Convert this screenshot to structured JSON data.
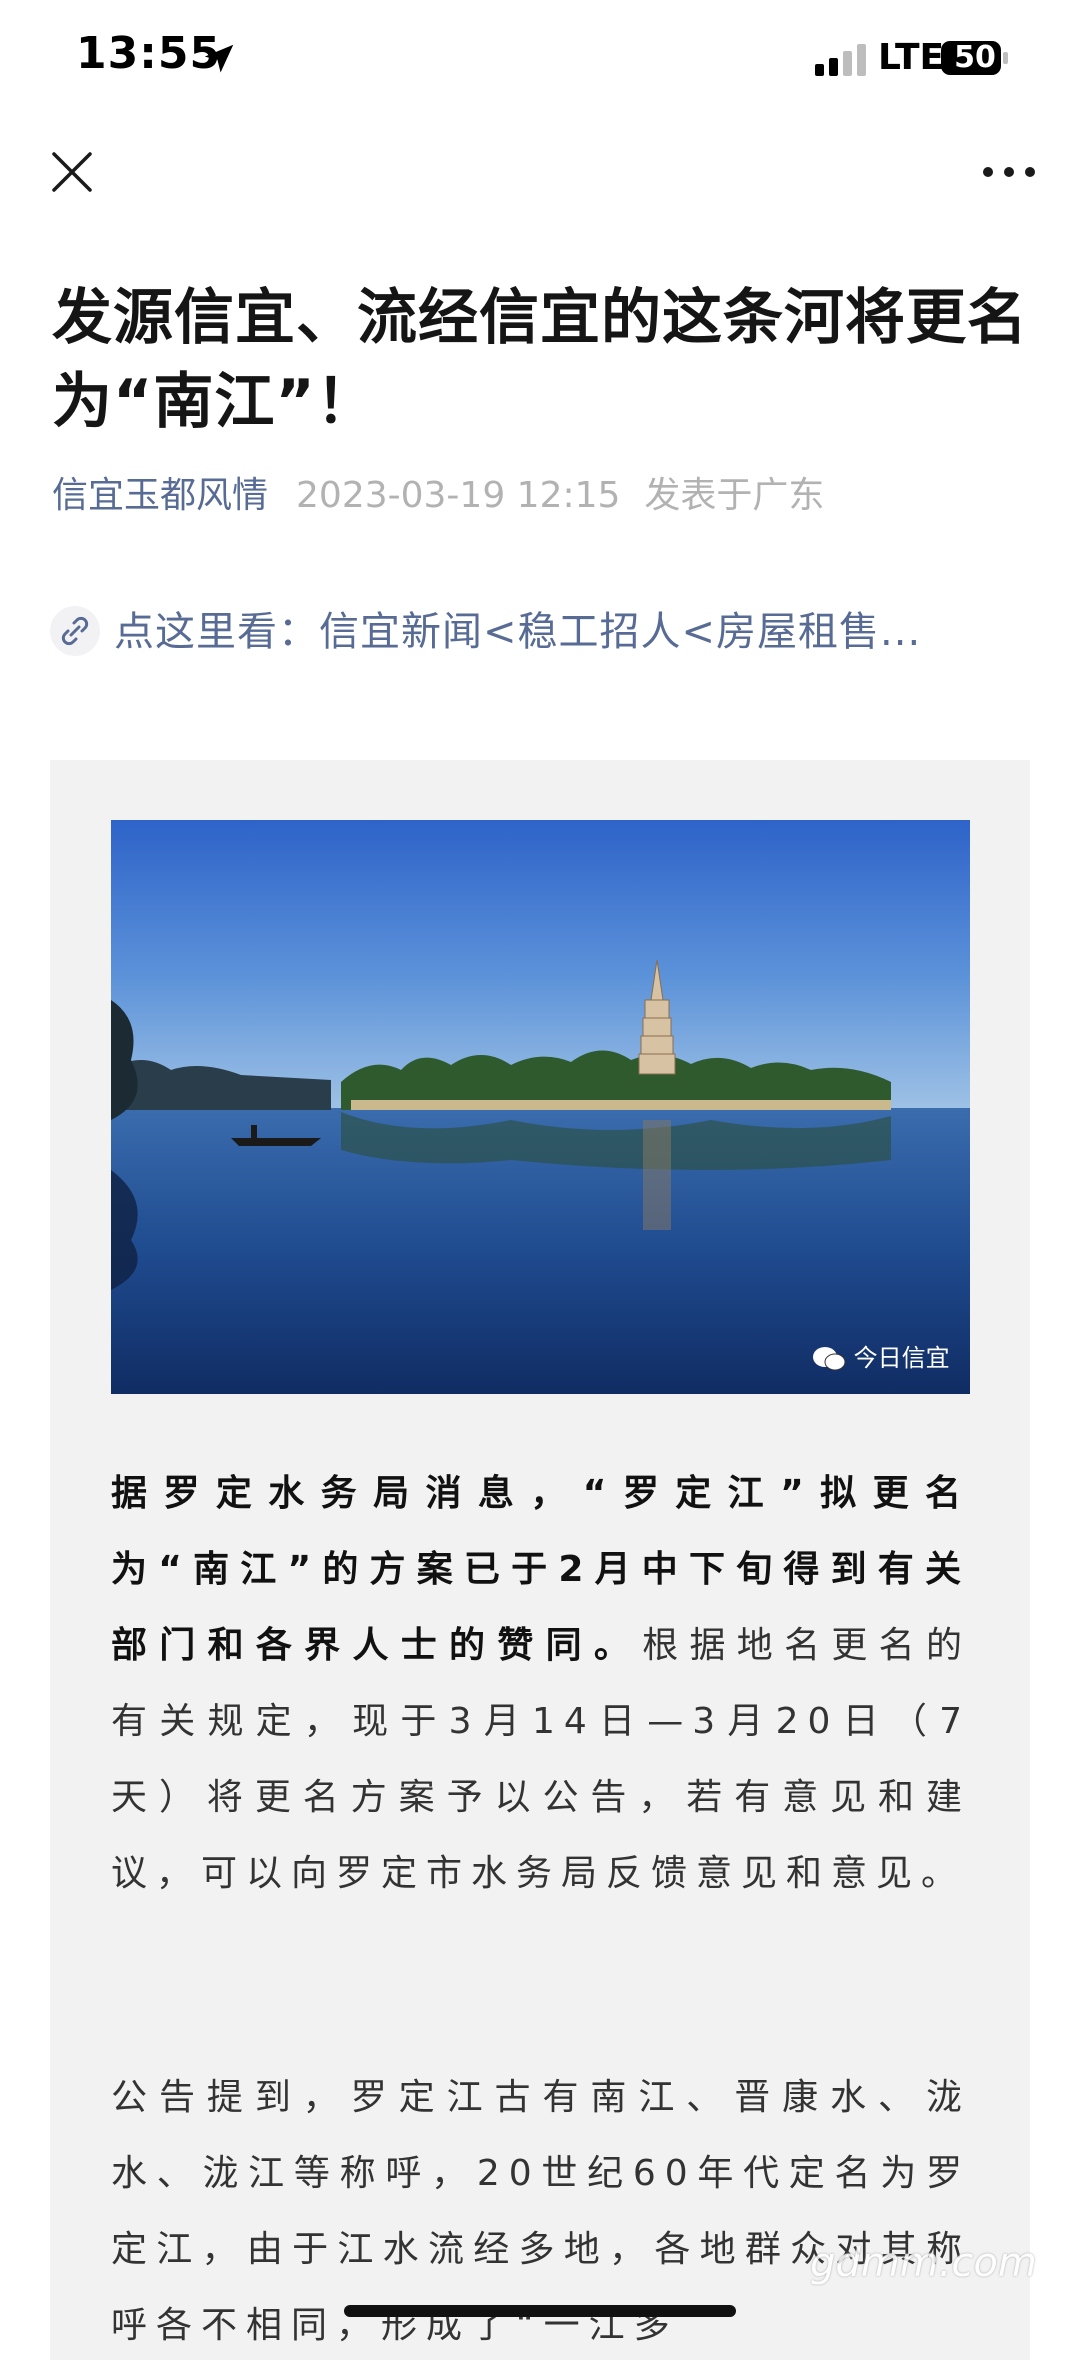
{
  "status_bar": {
    "time": "13:55",
    "network": "LTE",
    "battery": "50"
  },
  "nav": {
    "close_icon": "close-icon",
    "more_icon": "more-icon"
  },
  "article": {
    "title": "发源信宜、流经信宜的这条河将更名为“南江”！",
    "account": "信宜玉都风情",
    "date": "2023-03-19 12:15",
    "location": "发表于广东",
    "link_text": "点这里看：信宜新闻<稳工招人<房屋租售...",
    "image_watermark": "今日信宜",
    "para1_bold": "据罗定水务局消息，“罗定江”拟更名为“南江”的方案已于2月中下旬得到有关部门和各界人士的赞同。",
    "para1_rest": "根据地名更名的有关规定，现于3月14日—3月20日（7天）将更名方案予以公告，若有意见和建议，可以向罗定市水务局反馈意见和意见。",
    "para2": "公告提到，罗定江古有南江、晋康水、泷水、泷江等称呼，20世纪60年代定名为罗定江，由于江水流经多地，各地群众对其称呼各不相同，形成了“一江多"
  },
  "site_watermark": "gdmm.com",
  "colors": {
    "link": "#576b95",
    "meta_gray": "#b2b2b2",
    "card_bg": "#f2f2f2"
  }
}
